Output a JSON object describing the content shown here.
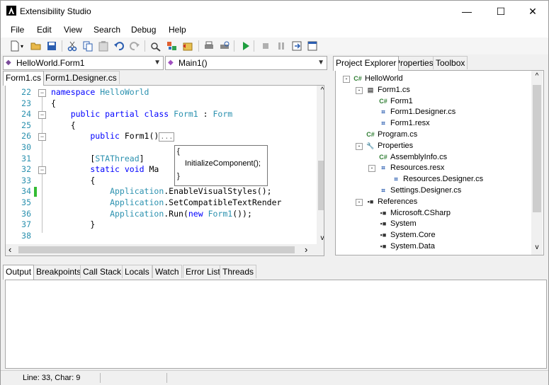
{
  "window": {
    "title": "Extensibility Studio",
    "minimize_glyph": "—",
    "maximize_glyph": "☐",
    "close_glyph": "✕"
  },
  "menu": [
    "File",
    "Edit",
    "View",
    "Search",
    "Debug",
    "Help"
  ],
  "toolbar_icons": [
    "new-file-icon",
    "open-folder-icon",
    "save-icon",
    "cut-icon",
    "copy-icon",
    "paste-icon",
    "undo-icon",
    "redo-icon",
    "find-icon",
    "build-icon",
    "package-icon",
    "print-icon",
    "print-preview-icon",
    "run-icon",
    "stop-icon",
    "pause-icon",
    "step-icon",
    "debug-window-icon"
  ],
  "nav": {
    "class_combo": "HelloWorld.Form1",
    "member_combo": "Main1()"
  },
  "editor": {
    "tabs": [
      "Form1.cs",
      "Form1.Designer.cs"
    ],
    "lines": [
      {
        "n": "22",
        "parts": [
          {
            "t": "namespace ",
            "c": "kw"
          },
          {
            "t": "HelloWorld",
            "c": "ty"
          }
        ]
      },
      {
        "n": "23",
        "parts": [
          {
            "t": "{",
            "c": ""
          }
        ]
      },
      {
        "n": "24",
        "parts": [
          {
            "t": "    public partial class ",
            "c": "kw"
          },
          {
            "t": "Form1",
            "c": "ty"
          },
          {
            "t": " : ",
            "c": ""
          },
          {
            "t": "Form",
            "c": "ty"
          }
        ]
      },
      {
        "n": "25",
        "parts": [
          {
            "t": "    {",
            "c": ""
          }
        ]
      },
      {
        "n": "26",
        "parts": [
          {
            "t": "        public ",
            "c": "kw"
          },
          {
            "t": "Form1()",
            "c": ""
          },
          {
            "t": "...",
            "c": "box"
          }
        ]
      },
      {
        "n": "30",
        "parts": [
          {
            "t": "",
            "c": ""
          }
        ]
      },
      {
        "n": "31",
        "parts": [
          {
            "t": "        [",
            "c": ""
          },
          {
            "t": "STAThread",
            "c": "ty"
          },
          {
            "t": "]",
            "c": ""
          }
        ]
      },
      {
        "n": "32",
        "parts": [
          {
            "t": "        static void ",
            "c": "kw"
          },
          {
            "t": "Ma",
            "c": ""
          }
        ]
      },
      {
        "n": "33",
        "parts": [
          {
            "t": "        {",
            "c": ""
          }
        ]
      },
      {
        "n": "34",
        "parts": [
          {
            "t": "            Application",
            "c": "ty"
          },
          {
            "t": ".EnableVisualStyles();",
            "c": ""
          }
        ]
      },
      {
        "n": "35",
        "parts": [
          {
            "t": "            Application",
            "c": "ty"
          },
          {
            "t": ".SetCompatibleTextRender",
            "c": ""
          }
        ]
      },
      {
        "n": "36",
        "parts": [
          {
            "t": "            Application",
            "c": "ty"
          },
          {
            "t": ".Run(",
            "c": ""
          },
          {
            "t": "new ",
            "c": "kw"
          },
          {
            "t": "Form1",
            "c": "ty"
          },
          {
            "t": "());",
            "c": ""
          }
        ]
      },
      {
        "n": "37",
        "parts": [
          {
            "t": "        }",
            "c": ""
          }
        ]
      },
      {
        "n": "38",
        "parts": [
          {
            "t": "",
            "c": ""
          }
        ]
      }
    ],
    "tooltip": {
      "open": "{",
      "text": "InitializeComponent();",
      "close": "}"
    },
    "scroll_left": "‹",
    "scroll_right": "›",
    "scroll_up": "^",
    "scroll_down": "v"
  },
  "right_panel": {
    "tabs": [
      "Project Explorer",
      "Properties",
      "Toolbox"
    ],
    "tree": [
      {
        "label": "HelloWorld",
        "depth": 0,
        "icon": "project-icon",
        "glyph": "C#",
        "exp": "-"
      },
      {
        "label": "Form1.cs",
        "depth": 1,
        "icon": "form-icon",
        "glyph": "▤",
        "exp": "-"
      },
      {
        "label": "Form1",
        "depth": 2,
        "icon": "csharp-class-icon",
        "glyph": "C#",
        "exp": ""
      },
      {
        "label": "Form1.Designer.cs",
        "depth": 2,
        "icon": "designer-file-icon",
        "glyph": "⌗",
        "exp": ""
      },
      {
        "label": "Form1.resx",
        "depth": 2,
        "icon": "resx-file-icon",
        "glyph": "⌗",
        "exp": ""
      },
      {
        "label": "Program.cs",
        "depth": 1,
        "icon": "csharp-file-icon",
        "glyph": "C#",
        "exp": ""
      },
      {
        "label": "Properties",
        "depth": 1,
        "icon": "wrench-icon",
        "glyph": "🔧",
        "exp": "-"
      },
      {
        "label": "AssemblyInfo.cs",
        "depth": 2,
        "icon": "csharp-file-icon",
        "glyph": "C#",
        "exp": ""
      },
      {
        "label": "Resources.resx",
        "depth": 2,
        "icon": "resx-file-icon",
        "glyph": "⌗",
        "exp": "-"
      },
      {
        "label": "Resources.Designer.cs",
        "depth": 3,
        "icon": "designer-file-icon",
        "glyph": "⌗",
        "exp": ""
      },
      {
        "label": "Settings.Designer.cs",
        "depth": 2,
        "icon": "designer-file-icon",
        "glyph": "⌗",
        "exp": ""
      },
      {
        "label": "References",
        "depth": 1,
        "icon": "references-icon",
        "glyph": "▪■",
        "exp": "-"
      },
      {
        "label": "Microsoft.CSharp",
        "depth": 2,
        "icon": "reference-icon",
        "glyph": "▪■",
        "exp": ""
      },
      {
        "label": "System",
        "depth": 2,
        "icon": "reference-icon",
        "glyph": "▪■",
        "exp": ""
      },
      {
        "label": "System.Core",
        "depth": 2,
        "icon": "reference-icon",
        "glyph": "▪■",
        "exp": ""
      },
      {
        "label": "System.Data",
        "depth": 2,
        "icon": "reference-icon",
        "glyph": "▪■",
        "exp": ""
      }
    ]
  },
  "bottom_tabs": [
    "Output",
    "Breakpoints",
    "Call Stack",
    "Locals",
    "Watch",
    "Error List",
    "Threads"
  ],
  "status": {
    "position": "Line: 33, Char: 9"
  },
  "colors": {
    "keyword": "#0000ff",
    "type": "#2b91af",
    "line_number": "#2b91af",
    "changed_marker": "#33bb33"
  }
}
